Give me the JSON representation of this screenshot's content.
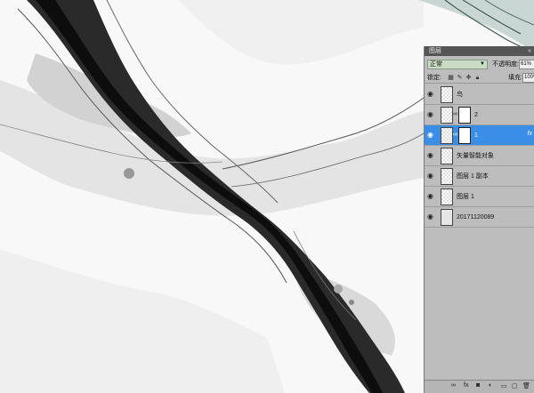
{
  "panel": {
    "title": "图层",
    "collapse_glyph": "«",
    "blend_mode": "正常",
    "opacity_label": "不透明度:",
    "opacity_value": "61%",
    "lock_label": "锁定:",
    "fill_label": "填充:",
    "fill_value": "100%"
  },
  "layers": [
    {
      "name": "鸟",
      "icon": "smart-object-thumbnail"
    },
    {
      "name": "2",
      "icon": "layer-with-mask"
    },
    {
      "name": "1",
      "icon": "layer-with-mask",
      "selected": true,
      "fx": "fx"
    },
    {
      "name": "矢量智能对象",
      "icon": "smart-object-thumbnail"
    },
    {
      "name": "图层 1 副本",
      "icon": "layer-thumbnail"
    },
    {
      "name": "图层 1",
      "icon": "layer-thumbnail"
    },
    {
      "name": "20171120089",
      "icon": "image-thumbnail"
    }
  ],
  "colors": {
    "selection": "#3b8ee6",
    "panel_bg": "#bdbdbd",
    "blend_field": "#c9ddc5"
  }
}
